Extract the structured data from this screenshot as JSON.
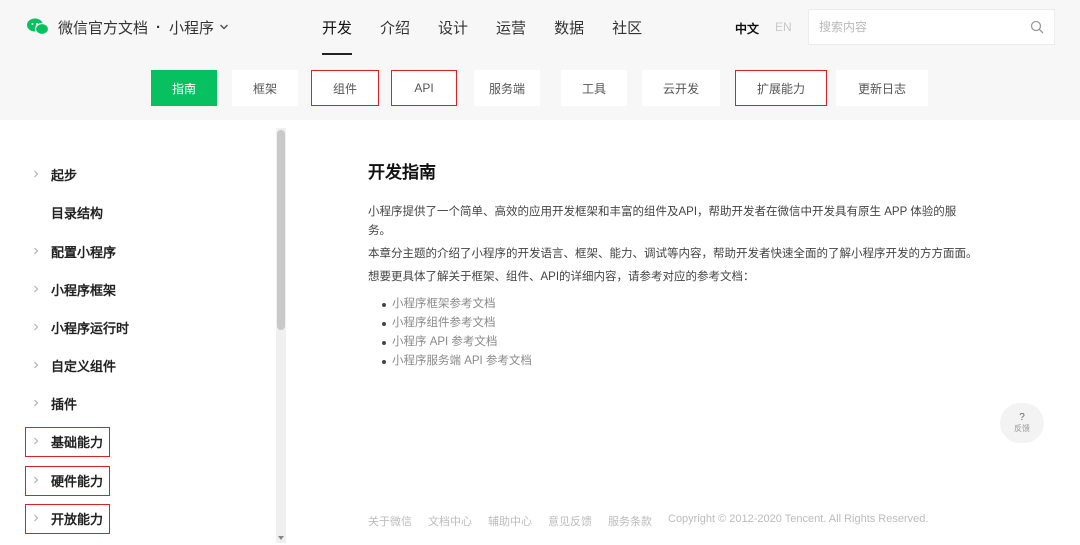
{
  "brand": {
    "title": "微信官方文档",
    "product": "小程序"
  },
  "main_nav": [
    {
      "label": "开发",
      "active": true
    },
    {
      "label": "介绍",
      "active": false
    },
    {
      "label": "设计",
      "active": false
    },
    {
      "label": "运营",
      "active": false
    },
    {
      "label": "数据",
      "active": false
    },
    {
      "label": "社区",
      "active": false
    }
  ],
  "lang": {
    "zh": "中文",
    "en": "EN"
  },
  "search": {
    "placeholder": "搜索内容"
  },
  "sub_nav": [
    {
      "label": "指南",
      "active": true
    },
    {
      "label": "框架",
      "active": false
    },
    {
      "label": "组件",
      "active": false,
      "highlighted": true
    },
    {
      "label": "API",
      "active": false,
      "highlighted": true
    },
    {
      "label": "服务端",
      "active": false
    },
    {
      "label": "工具",
      "active": false
    },
    {
      "label": "云开发",
      "active": false
    },
    {
      "label": "扩展能力",
      "active": false,
      "highlighted": true
    },
    {
      "label": "更新日志",
      "active": false
    }
  ],
  "sidebar": {
    "items": [
      {
        "label": "起步",
        "has_arrow": true,
        "highlighted": false
      },
      {
        "label": "目录结构",
        "has_arrow": false,
        "highlighted": false
      },
      {
        "label": "配置小程序",
        "has_arrow": true,
        "highlighted": false
      },
      {
        "label": "小程序框架",
        "has_arrow": true,
        "highlighted": false
      },
      {
        "label": "小程序运行时",
        "has_arrow": true,
        "highlighted": false
      },
      {
        "label": "自定义组件",
        "has_arrow": true,
        "highlighted": false
      },
      {
        "label": "插件",
        "has_arrow": true,
        "highlighted": false
      },
      {
        "label": "基础能力",
        "has_arrow": true,
        "highlighted": true
      },
      {
        "label": "硬件能力",
        "has_arrow": true,
        "highlighted": true
      },
      {
        "label": "开放能力",
        "has_arrow": true,
        "highlighted": true
      }
    ]
  },
  "content": {
    "title": "开发指南",
    "paragraphs": [
      "小程序提供了一个简单、高效的应用开发框架和丰富的组件及API，帮助开发者在微信中开发具有原生 APP 体验的服务。",
      "本章分主题的介绍了小程序的开发语言、框架、能力、调试等内容，帮助开发者快速全面的了解小程序开发的方方面面。",
      "想要更具体了解关于框架、组件、API的详细内容，请参考对应的参考文档："
    ],
    "links": [
      "小程序框架参考文档",
      "小程序组件参考文档",
      "小程序 API 参考文档",
      "小程序服务端 API 参考文档"
    ]
  },
  "footer": {
    "links": [
      "关于微信",
      "文档中心",
      "辅助中心",
      "意见反馈",
      "服务条款"
    ],
    "copyright": "Copyright © 2012-2020 Tencent. All Rights Reserved."
  },
  "feedback": {
    "label": "反馈",
    "icon": "?"
  },
  "colors": {
    "accent": "#07c160",
    "highlight_box": "#e02020"
  }
}
